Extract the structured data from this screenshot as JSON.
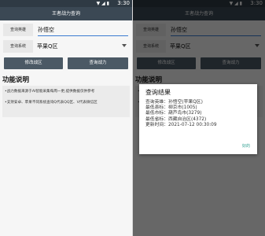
{
  "status_bar": {
    "signal_icons": "▼ ◢ ▮",
    "time": "3:30"
  },
  "app": {
    "title": "王者战力查询"
  },
  "form": {
    "hero_label": "查询英雄",
    "hero_value": "孙悟空",
    "system_label": "查询系统",
    "system_value": "苹果Q区"
  },
  "buttons": {
    "modify": "修改战区",
    "query": "查询战力"
  },
  "section": {
    "title": "功能说明",
    "notes": [
      "•战力数据来源于AI智能采集每周一更,提供数据仅供参考",
      "•支持安卓、苹果不同系统查询Q代表QQ区、V代表微信区"
    ]
  },
  "dialog": {
    "title": "查询结果",
    "lines": [
      "查询英雄：孙悟空(苹果Q区)",
      "最低县标：柳京市(1005)",
      "最低市标：葫芦岛市(3279)",
      "最低省标：西藏自治区(4372)",
      "更新时间：2021-07-12 00:30:09"
    ],
    "close_label": "好的"
  }
}
